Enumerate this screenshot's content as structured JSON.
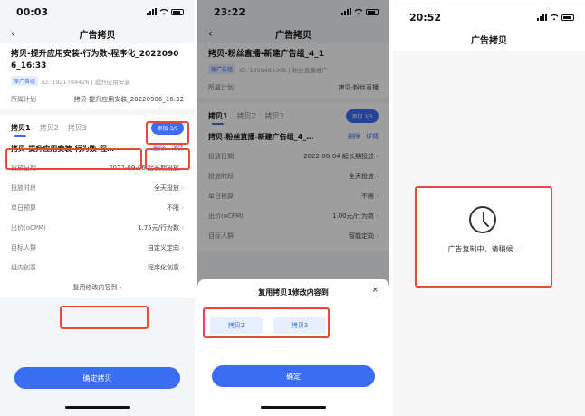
{
  "screens": {
    "s1": {
      "time": "00:03",
      "nav_title": "广告拷贝",
      "ad_title": "拷贝-提升应用安装-行为数-程序化_20220906_16:33",
      "id_tag": "原广告组",
      "id_text": "ID: 1921784426 | 提升应用安装",
      "plan_label": "所属计划",
      "plan_value": "拷贝-提升应用安装_20220906_16:32",
      "tabs": [
        "拷贝1",
        "拷贝2",
        "拷贝3"
      ],
      "add_label": "添加 3/5",
      "card_name": "拷贝-提升应用安装-行为数-程…",
      "delete_label": "删除",
      "detail_label": "详情",
      "rows": [
        {
          "label": "投放日期",
          "value": "2022-09-06 起长期投放"
        },
        {
          "label": "投放时段",
          "value": "全天投放"
        },
        {
          "label": "单日预算",
          "value": "不限"
        },
        {
          "label": "出价(oCPM)",
          "value": "1.75元/行为数"
        },
        {
          "label": "目标人群",
          "value": "自定义定向"
        },
        {
          "label": "组内创意",
          "value": "程序化创意"
        }
      ],
      "reuse_label": "复用修改内容到 ›",
      "confirm_label": "确定拷贝"
    },
    "s2": {
      "time": "23:22",
      "nav_title": "广告拷贝",
      "ad_title": "拷贝-粉丝直播-新建广告组_4_1",
      "id_tag": "原广告组",
      "id_text": "ID: 1859484305 | 粉丝直播推广",
      "plan_label": "所属计划",
      "plan_value": "拷贝-粉丝直播",
      "tabs": [
        "拷贝1",
        "拷贝2",
        "拷贝3"
      ],
      "add_label": "添加 3/5",
      "card_name": "拷贝-粉丝直播-新建广告组_4_…",
      "delete_label": "删除",
      "detail_label": "详情",
      "rows": [
        {
          "label": "投放日期",
          "value": "2022-08-04 起长期投放"
        },
        {
          "label": "投放时段",
          "value": "全天投放"
        },
        {
          "label": "单日预算",
          "value": "不限"
        },
        {
          "label": "出价(oCPM)",
          "value": "1.00元/行为数"
        },
        {
          "label": "目标人群",
          "value": "智能定向"
        }
      ],
      "sheet_title": "复用拷贝1修改内容到",
      "close_label": "×",
      "chips": [
        "拷贝2",
        "拷贝3"
      ],
      "confirm_label": "确定"
    },
    "s3": {
      "time": "20:52",
      "nav_title": "广告拷贝",
      "loading_text": "广告复制中，请稍候.."
    }
  },
  "colors": {
    "accent": "#3a6cf4",
    "highlight": "#e94a37"
  }
}
